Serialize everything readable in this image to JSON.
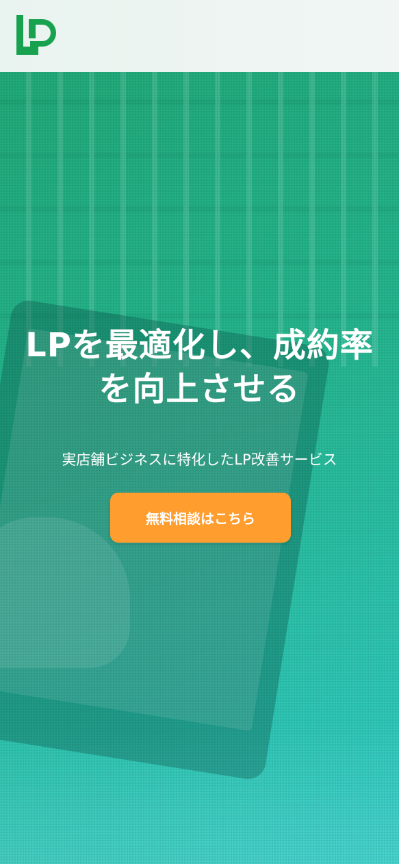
{
  "header": {
    "logo_text": "LP",
    "logo_color": "#18a24f"
  },
  "hero": {
    "headline": "LPを最適化し、成約率を向上させる",
    "subcopy": "実店舗ビジネスに特化したLP改善サービス",
    "cta_label": "無料相談はこちら",
    "cta_color": "#ff9d2e",
    "overlay_color": "#25b38c"
  }
}
